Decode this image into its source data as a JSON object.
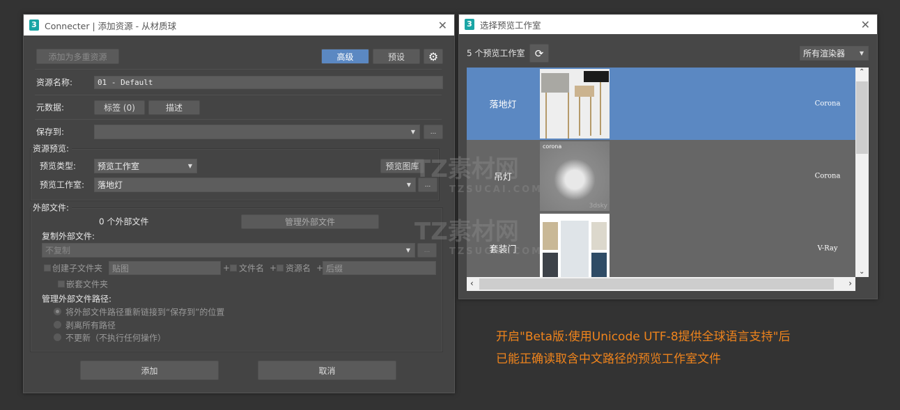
{
  "left_dialog": {
    "title": "Connecter | 添加资源 - 从材质球",
    "app_icon": "3",
    "add_multi_label": "添加为多重资源",
    "advanced_label": "高级",
    "preset_label": "预设",
    "asset_name_label": "资源名称:",
    "asset_name_value": "01 - Default",
    "metadata_label": "元数据:",
    "tags_label": "标签 (0)",
    "describe_label": "描述",
    "save_to_label": "保存到:",
    "save_to_value": "",
    "ellipsis": "...",
    "preview_group": "资源预览:",
    "preview_type_label": "预览类型:",
    "preview_type_value": "预览工作室",
    "preview_gallery_label": "预览图库",
    "preview_studio_label": "预览工作室:",
    "preview_studio_value": "落地灯",
    "external_group": "外部文件:",
    "external_count": "0 个外部文件",
    "manage_external_label": "管理外部文件",
    "copy_external_label": "复制外部文件:",
    "copy_external_value": "不复制",
    "create_subfolder_label": "创建子文件夹",
    "subfolder_value": "贴图",
    "plus": "+",
    "filename_label": "文件名",
    "assetname_label": "资源名",
    "suffix_placeholder": "后缀",
    "nested_label": "嵌套文件夹",
    "manage_paths_label": "管理外部文件路径:",
    "radio_options": [
      "将外部文件路径重新链接到“保存到”的位置",
      "剥离所有路径",
      "不更新（不执行任何操作）"
    ],
    "add_label": "添加",
    "cancel_label": "取消"
  },
  "right_dialog": {
    "title": "选择预览工作室",
    "count_label": "5 个预览工作室",
    "renderer_filter": "所有渲染器",
    "items": [
      {
        "name": "落地灯",
        "renderer": "Corona",
        "selected": true
      },
      {
        "name": "吊灯",
        "renderer": "Corona",
        "selected": false,
        "thumb_text": "corona",
        "thumb_mark": "3dsky"
      },
      {
        "name": "套装门",
        "renderer": "V-Ray",
        "selected": false
      }
    ]
  },
  "caption": {
    "line1": "开启\"Beta版:使用Unicode UTF-8提供全球语言支持\"后",
    "line2": "已能正确读取含中文路径的预览工作室文件"
  },
  "watermark": {
    "cn": "TZ素材网",
    "en": "TZSUCAI.COM"
  },
  "colors": {
    "accent": "#5b88c2",
    "caption": "#f0841c"
  }
}
